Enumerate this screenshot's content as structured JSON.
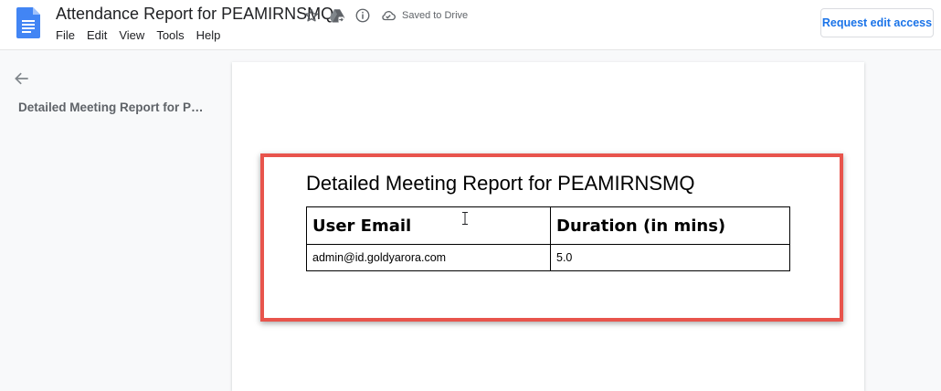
{
  "header": {
    "doc_title": "Attendance Report for PEAMIRNSMQ",
    "saved_status": "Saved to Drive",
    "request_access_label": "Request edit access",
    "icons": [
      "docs-logo-icon",
      "star-icon",
      "drive-move-icon",
      "info-icon",
      "cloud-saved-icon"
    ]
  },
  "menu": [
    {
      "label": "File"
    },
    {
      "label": "Edit"
    },
    {
      "label": "View"
    },
    {
      "label": "Tools"
    },
    {
      "label": "Help"
    }
  ],
  "outline": {
    "back_icon": "arrow-left-icon",
    "items": [
      {
        "label": "Detailed Meeting Report for P…"
      }
    ]
  },
  "document": {
    "heading": "Detailed Meeting Report for PEAMIRNSMQ",
    "table": {
      "headers": [
        "User Email",
        "Duration (in mins)"
      ],
      "rows": [
        [
          "admin@id.goldyarora.com",
          "5.0"
        ]
      ]
    }
  },
  "colors": {
    "accent": "#1a73e8",
    "highlight_border": "#e8544c",
    "docs_blue": "#4285f4"
  }
}
